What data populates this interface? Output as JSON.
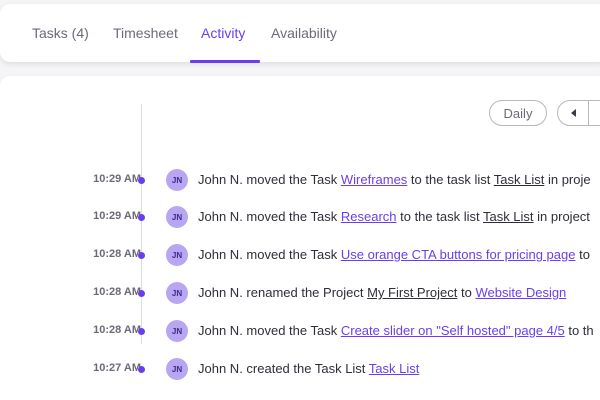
{
  "tabs": [
    {
      "label": "Tasks (4)"
    },
    {
      "label": "Timesheet"
    },
    {
      "label": "Activity"
    },
    {
      "label": "Availability"
    }
  ],
  "active_tab": "Activity",
  "toolbar": {
    "daily_label": "Daily",
    "prev_icon": "caret-left-icon"
  },
  "colors": {
    "accent": "#6a3ef0",
    "avatar_bg": "#b8a6f2"
  },
  "activity": [
    {
      "time": "10:29 AM",
      "avatar": "JN",
      "user": "John N.",
      "verb": " moved the Task ",
      "object_link": "Wireframes",
      "middle": " to the task list ",
      "target_link": "Task List",
      "tail": " in proje"
    },
    {
      "time": "10:29 AM",
      "avatar": "JN",
      "user": "John N.",
      "verb": " moved the Task ",
      "object_link": "Research",
      "middle": " to the task list ",
      "target_link": "Task List",
      "tail": " in project"
    },
    {
      "time": "10:28 AM",
      "avatar": "JN",
      "user": "John N.",
      "verb": " moved the Task ",
      "object_link": "Use orange CTA buttons for pricing page",
      "tail": " to"
    },
    {
      "time": "10:28 AM",
      "avatar": "JN",
      "user": "John N.",
      "verb": " renamed the Project ",
      "object_link": "My First Project",
      "middle": " to ",
      "target_link": "Website Design"
    },
    {
      "time": "10:28 AM",
      "avatar": "JN",
      "user": "John N.",
      "verb": " moved the Task ",
      "object_link": "Create slider on \"Self hosted\" page 4/5",
      "tail": " to th"
    },
    {
      "time": "10:27 AM",
      "avatar": "JN",
      "user": "John N.",
      "verb": " created the Task List ",
      "object_link": "Task List"
    }
  ]
}
